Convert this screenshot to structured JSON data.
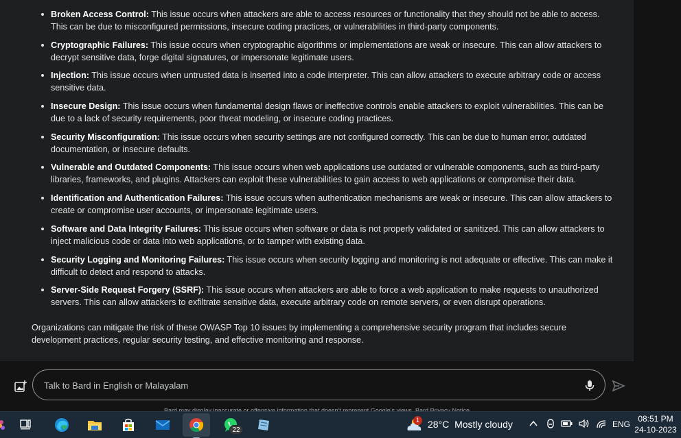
{
  "issues": [
    {
      "title": "Broken Access Control:",
      "text": " This issue occurs when attackers are able to access resources or functionality that they should not be able to access. This can be due to misconfigured permissions, insecure coding practices, or vulnerabilities in third-party components."
    },
    {
      "title": "Cryptographic Failures:",
      "text": " This issue occurs when cryptographic algorithms or implementations are weak or insecure. This can allow attackers to decrypt sensitive data, forge digital signatures, or impersonate legitimate users."
    },
    {
      "title": "Injection:",
      "text": " This issue occurs when untrusted data is inserted into a code interpreter. This can allow attackers to execute arbitrary code or access sensitive data."
    },
    {
      "title": "Insecure Design:",
      "text": " This issue occurs when fundamental design flaws or ineffective controls enable attackers to exploit vulnerabilities. This can be due to a lack of security requirements, poor threat modeling, or insecure coding practices."
    },
    {
      "title": "Security Misconfiguration:",
      "text": " This issue occurs when security settings are not configured correctly. This can be due to human error, outdated documentation, or insecure defaults."
    },
    {
      "title": "Vulnerable and Outdated Components:",
      "text": " This issue occurs when web applications use outdated or vulnerable components, such as third-party libraries, frameworks, and plugins. Attackers can exploit these vulnerabilities to gain access to web applications or compromise their data."
    },
    {
      "title": "Identification and Authentication Failures:",
      "text": " This issue occurs when authentication mechanisms are weak or insecure. This can allow attackers to create or compromise user accounts, or impersonate legitimate users."
    },
    {
      "title": "Software and Data Integrity Failures:",
      "text": " This issue occurs when software or data is not properly validated or sanitized. This can allow attackers to inject malicious code or data into web applications, or to tamper with existing data."
    },
    {
      "title": "Security Logging and Monitoring Failures:",
      "text": " This issue occurs when security logging and monitoring is not adequate or effective. This can make it difficult to detect and respond to attacks."
    },
    {
      "title": "Server-Side Request Forgery (SSRF):",
      "text": " This issue occurs when attackers are able to force a web application to make requests to unauthorized servers. This can allow attackers to exfiltrate sensitive data, execute arbitrary code on remote servers, or even disrupt operations."
    }
  ],
  "summary": "Organizations can mitigate the risk of these OWASP Top 10 issues by implementing a comprehensive security program that includes secure development practices, regular security testing, and effective monitoring and response.",
  "prompt": {
    "placeholder": "Talk to Bard in English or Malayalam",
    "value": ""
  },
  "disclaimer": "Bard may display inaccurate or offensive information that doesn't represent Google's views. Bard Privacy Notice",
  "taskbar": {
    "apps": [
      {
        "name": "task-view",
        "icon": "task-view-icon"
      },
      {
        "name": "edge",
        "icon": "edge-icon"
      },
      {
        "name": "file-explorer",
        "icon": "folder-icon"
      },
      {
        "name": "microsoft-store",
        "icon": "store-icon"
      },
      {
        "name": "mail",
        "icon": "mail-icon"
      },
      {
        "name": "chrome",
        "icon": "chrome-icon"
      },
      {
        "name": "whatsapp",
        "icon": "whatsapp-icon"
      },
      {
        "name": "notes",
        "icon": "notes-icon"
      }
    ],
    "whatsapp_badge": "22",
    "weather": {
      "temp": "28°C",
      "condition": "Mostly cloudy",
      "alert_count": "1"
    },
    "language": "ENG",
    "time": "08:51 PM",
    "date": "24-10-2023"
  },
  "colors": {
    "panel": "#1e1f20",
    "background": "#131314",
    "taskbar": "#1c2a38",
    "text": "#e3e3e3"
  }
}
